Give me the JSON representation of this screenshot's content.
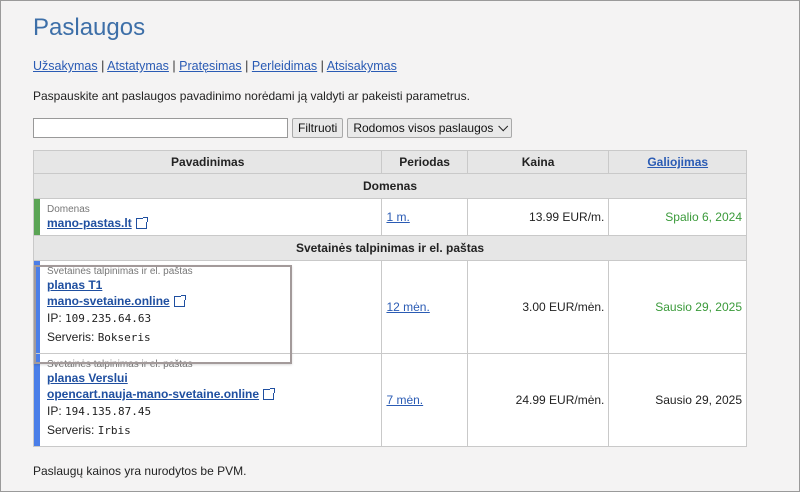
{
  "title": "Paslaugos",
  "links": [
    "Užsakymas",
    "Atstatymas",
    "Pratęsimas",
    "Perleidimas",
    "Atsisakymas"
  ],
  "intro": "Paspauskite ant paslaugos pavadinimo norėdami ją valdyti ar pakeisti parametrus.",
  "filter": {
    "input_value": "",
    "button": "Filtruoti",
    "select_value": "Rodomos visos paslaugos"
  },
  "table": {
    "headers": {
      "name": "Pavadinimas",
      "period": "Periodas",
      "price": "Kaina",
      "expiry": "Galiojimas"
    },
    "groups": [
      {
        "title": "Domenas"
      },
      {
        "title": "Svetainės talpinimas ir el. paštas"
      }
    ],
    "rows": [
      {
        "category": "Domenas",
        "name": "mano-pastas.lt",
        "period": "1 m.",
        "price": "13.99 EUR/m.",
        "expiry": "Spalio 6, 2024",
        "bar_color": "#5aa454",
        "expiry_color": "#3a9a3a"
      },
      {
        "category": "Svetainės talpinimas ir el. paštas",
        "plan": "planas T1",
        "domain": "mano-svetaine.online",
        "ip_label": "IP:",
        "ip": "109.235.64.63",
        "server_label": "Serveris:",
        "server": "Bokseris",
        "period": "12 mėn.",
        "price": "3.00 EUR/mėn.",
        "expiry": "Sausio 29, 2025",
        "bar_color": "#4a7ee8",
        "expiry_color": "#3a9a3a"
      },
      {
        "category": "Svetainės talpinimas ir el. paštas",
        "plan": "planas Verslui",
        "domain": "opencart.nauja-mano-svetaine.online",
        "ip_label": "IP:",
        "ip": "194.135.87.45",
        "server_label": "Serveris:",
        "server": "Irbis",
        "period": "7 mėn.",
        "price": "24.99 EUR/mėn.",
        "expiry": "Sausio 29, 2025",
        "bar_color": "#4a7ee8",
        "expiry_color": "#222222"
      }
    ]
  },
  "footer": "Paslaugų kainos yra nurodytos be PVM."
}
